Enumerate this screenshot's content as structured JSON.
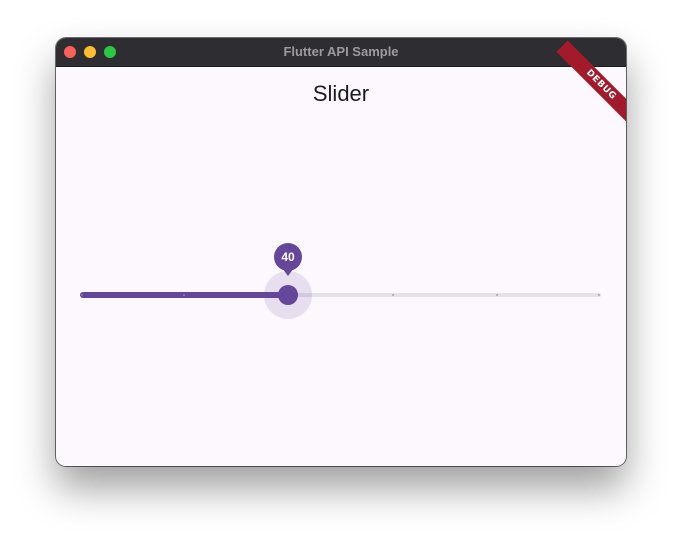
{
  "window": {
    "title": "Flutter API Sample",
    "controls": [
      "close",
      "minimize",
      "zoom"
    ]
  },
  "app": {
    "title": "Slider",
    "debug_banner": "DEBUG"
  },
  "slider": {
    "value": 40,
    "label": "40",
    "min": 0,
    "max": 100,
    "divisions": 5,
    "active_color": "#64469b",
    "inactive_color": "#e5dfe8"
  },
  "colors": {
    "background": "#fdf7fe",
    "titlebar": "#2e2d31",
    "close": "#fe5f57",
    "minimize": "#febc2e",
    "zoom": "#28c840",
    "debug": "#a31b2b"
  }
}
